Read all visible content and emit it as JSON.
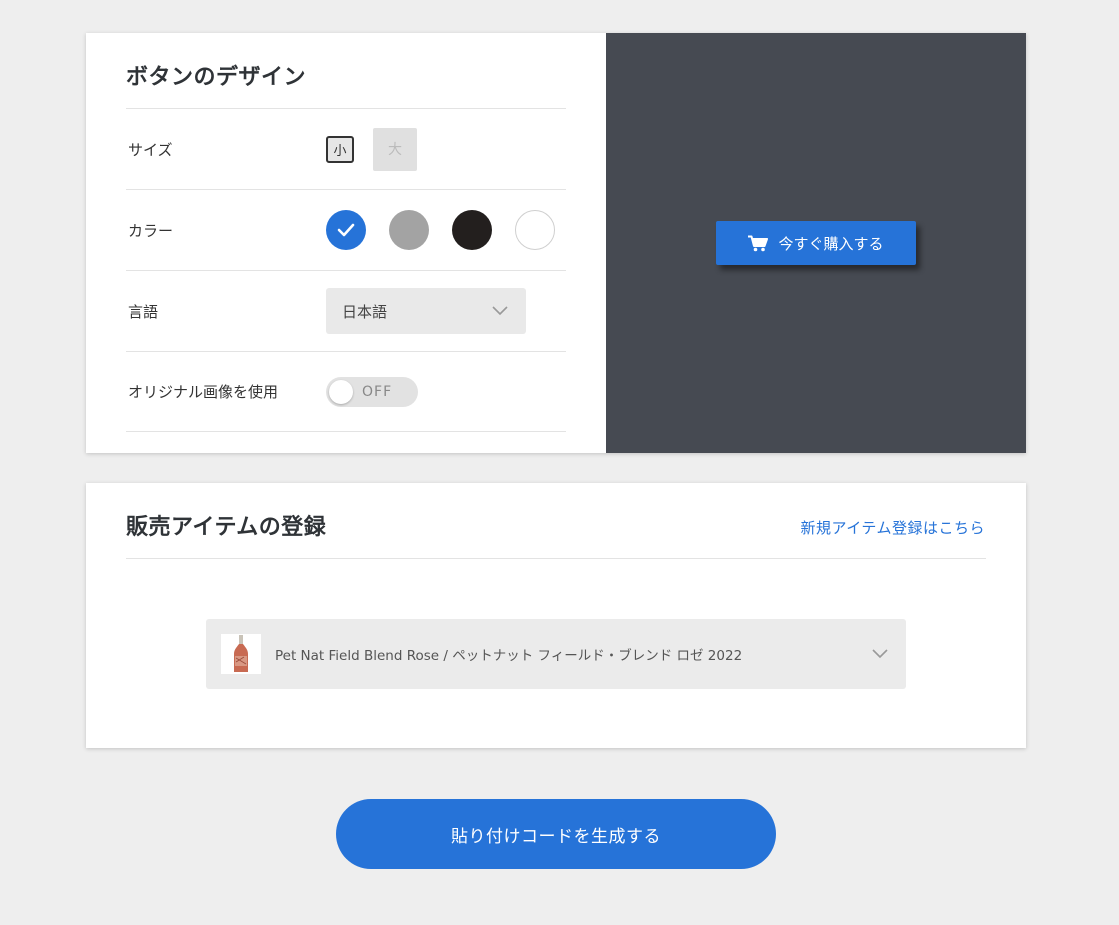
{
  "design": {
    "title": "ボタンのデザイン",
    "size": {
      "label": "サイズ",
      "small": "小",
      "large": "大",
      "selected": "small"
    },
    "color": {
      "label": "カラー",
      "swatches": [
        {
          "name": "blue",
          "hex": "#2673d8",
          "selected": true
        },
        {
          "name": "gray",
          "hex": "#a3a3a3",
          "selected": false
        },
        {
          "name": "black",
          "hex": "#231f1e",
          "selected": false
        },
        {
          "name": "white",
          "hex": "#ffffff",
          "selected": false
        }
      ]
    },
    "language": {
      "label": "言語",
      "value": "日本語"
    },
    "original_image": {
      "label": "オリジナル画像を使用",
      "toggle_text": "OFF",
      "on": false
    }
  },
  "preview": {
    "background": "#464a52",
    "button_label": "今すぐ購入する",
    "button_icon": "cart-icon"
  },
  "items": {
    "title": "販売アイテムの登録",
    "new_item_link": "新規アイテム登録はこちら",
    "selected_item": "Pet Nat Field Blend Rose / ペットナット フィールド・ブレンド ロゼ 2022"
  },
  "generate_button": "貼り付けコードを生成する"
}
